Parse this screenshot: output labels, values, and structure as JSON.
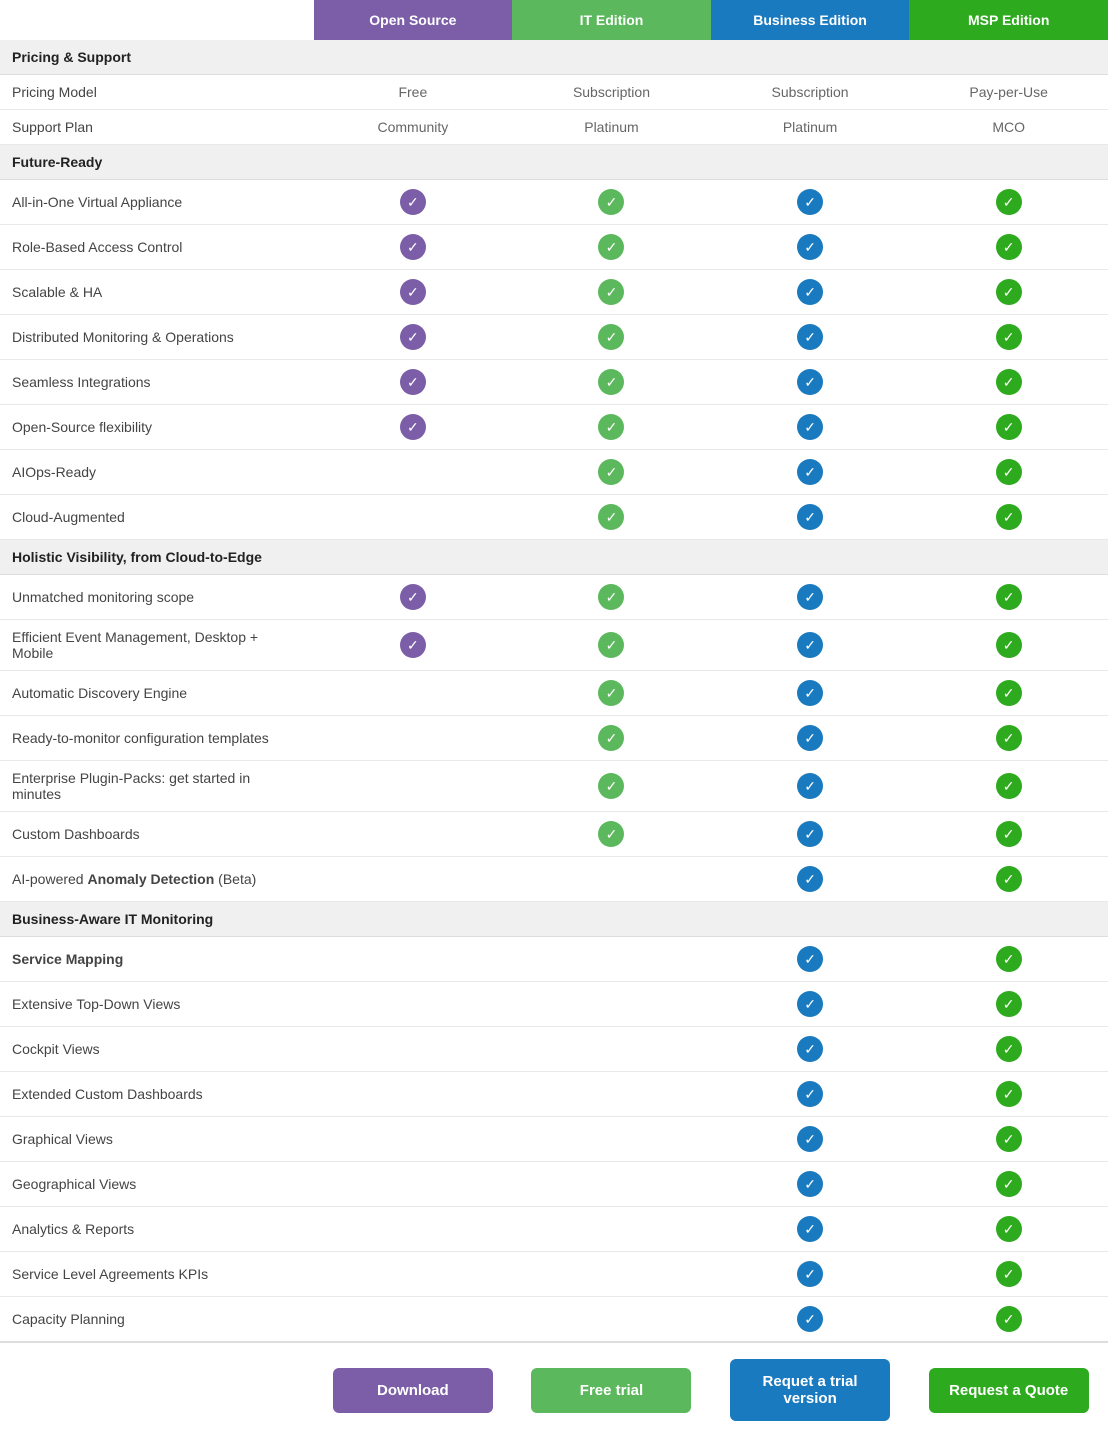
{
  "header": {
    "col_feature": "",
    "col_opensource": "Open Source",
    "col_it": "IT Edition",
    "col_business": "Business Edition",
    "col_msp": "MSP Edition"
  },
  "sections": [
    {
      "type": "section-header",
      "label": "Pricing & Support"
    },
    {
      "type": "data-row",
      "feature": "Pricing Model",
      "opensource": "Free",
      "it": "Subscription",
      "business": "Subscription",
      "msp": "Pay-per-Use",
      "opensource_type": "text",
      "it_type": "text",
      "business_type": "text",
      "msp_type": "text"
    },
    {
      "type": "data-row",
      "feature": "Support Plan",
      "opensource": "Community",
      "it": "Platinum",
      "business": "Platinum",
      "msp": "MCO",
      "opensource_type": "text",
      "it_type": "text",
      "business_type": "text",
      "msp_type": "text"
    },
    {
      "type": "section-header",
      "label": "Future-Ready"
    },
    {
      "type": "check-row",
      "feature": "All-in-One Virtual Appliance",
      "opensource": true,
      "it": true,
      "business": true,
      "msp": true
    },
    {
      "type": "check-row",
      "feature": "Role-Based Access Control",
      "opensource": true,
      "it": true,
      "business": true,
      "msp": true
    },
    {
      "type": "check-row",
      "feature": "Scalable & HA",
      "opensource": true,
      "it": true,
      "business": true,
      "msp": true
    },
    {
      "type": "check-row",
      "feature": "Distributed Monitoring & Operations",
      "opensource": true,
      "it": true,
      "business": true,
      "msp": true
    },
    {
      "type": "check-row",
      "feature": "Seamless Integrations",
      "opensource": true,
      "it": true,
      "business": true,
      "msp": true
    },
    {
      "type": "check-row",
      "feature": "Open-Source flexibility",
      "opensource": true,
      "it": true,
      "business": true,
      "msp": true
    },
    {
      "type": "check-row",
      "feature": "AIOps-Ready",
      "opensource": false,
      "it": true,
      "business": true,
      "msp": true
    },
    {
      "type": "check-row",
      "feature": "Cloud-Augmented",
      "opensource": false,
      "it": true,
      "business": true,
      "msp": true
    },
    {
      "type": "section-header",
      "label": "Holistic Visibility, from Cloud-to-Edge"
    },
    {
      "type": "check-row",
      "feature": "Unmatched monitoring scope",
      "opensource": true,
      "it": true,
      "business": true,
      "msp": true
    },
    {
      "type": "check-row",
      "feature": "Efficient Event Management, Desktop + Mobile",
      "opensource": true,
      "it": true,
      "business": true,
      "msp": true
    },
    {
      "type": "check-row",
      "feature": "Automatic Discovery Engine",
      "opensource": false,
      "it": true,
      "business": true,
      "msp": true
    },
    {
      "type": "check-row",
      "feature": "Ready-to-monitor configuration templates",
      "opensource": false,
      "it": true,
      "business": true,
      "msp": true
    },
    {
      "type": "check-row",
      "feature": "Enterprise Plugin-Packs: get started in minutes",
      "opensource": false,
      "it": true,
      "business": true,
      "msp": true
    },
    {
      "type": "check-row",
      "feature": "Custom Dashboards",
      "opensource": false,
      "it": true,
      "business": true,
      "msp": true
    },
    {
      "type": "check-row-special",
      "feature": "AI-powered <strong>Anomaly Detection</strong> (Beta)",
      "opensource": false,
      "it": false,
      "business": true,
      "msp": true
    },
    {
      "type": "section-header",
      "label": "Business-Aware IT Monitoring"
    },
    {
      "type": "check-row-bold",
      "feature": "Service Mapping",
      "feature_bold": true,
      "opensource": false,
      "it": false,
      "business": true,
      "msp": true
    },
    {
      "type": "check-row",
      "feature": "Extensive Top-Down Views",
      "opensource": false,
      "it": false,
      "business": true,
      "msp": true
    },
    {
      "type": "check-row",
      "feature": "Cockpit Views",
      "opensource": false,
      "it": false,
      "business": true,
      "msp": true
    },
    {
      "type": "check-row",
      "feature": "Extended Custom Dashboards",
      "opensource": false,
      "it": false,
      "business": true,
      "msp": true
    },
    {
      "type": "check-row",
      "feature": "Graphical Views",
      "opensource": false,
      "it": false,
      "business": true,
      "msp": true
    },
    {
      "type": "check-row",
      "feature": "Geographical Views",
      "opensource": false,
      "it": false,
      "business": true,
      "msp": true
    },
    {
      "type": "check-row",
      "feature": "Analytics & Reports",
      "opensource": false,
      "it": false,
      "business": true,
      "msp": true
    },
    {
      "type": "check-row",
      "feature": "Service Level Agreements KPIs",
      "opensource": false,
      "it": false,
      "business": true,
      "msp": true
    },
    {
      "type": "check-row",
      "feature": "Capacity Planning",
      "opensource": false,
      "it": false,
      "business": true,
      "msp": true
    }
  ],
  "footer": {
    "btn_opensource": "Download",
    "btn_it": "Free trial",
    "btn_business": "Requet a trial version",
    "btn_msp": "Request a Quote"
  },
  "colors": {
    "purple": "#7b5ea7",
    "green_light": "#5cb85c",
    "blue": "#1a7abf",
    "green": "#2daa1e"
  }
}
